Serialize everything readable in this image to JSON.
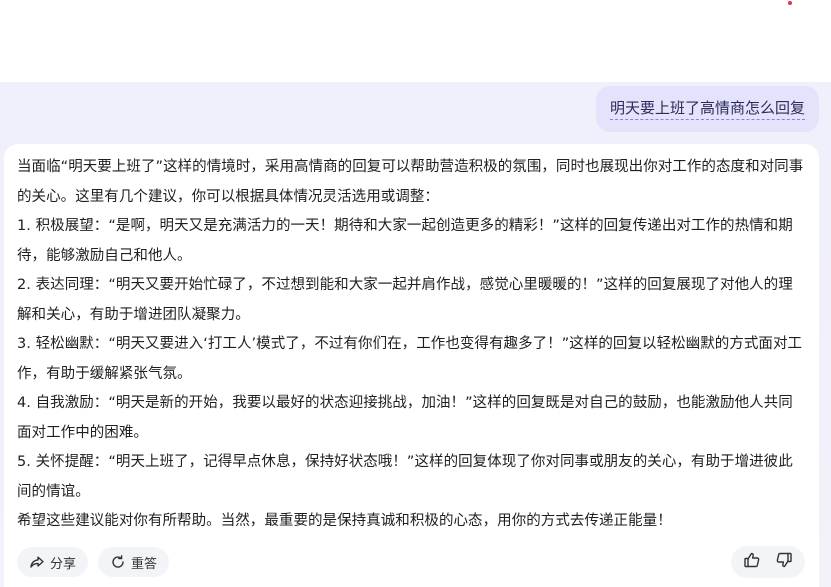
{
  "conversation": {
    "user_message": "明天要上班了高情商怎么回复",
    "assistant_paragraphs": [
      "当面临“明天要上班了”这样的情境时，采用高情商的回复可以帮助营造积极的氛围，同时也展现出你对工作的态度和对同事的关心。这里有几个建议，你可以根据具体情况灵活选用或调整：",
      "1. 积极展望：“是啊，明天又是充满活力的一天！期待和大家一起创造更多的精彩！”这样的回复传递出对工作的热情和期待，能够激励自己和他人。",
      "2. 表达同理：“明天又要开始忙碌了，不过想到能和大家一起并肩作战，感觉心里暖暖的！”这样的回复展现了对他人的理解和关心，有助于增进团队凝聚力。",
      "3. 轻松幽默：“明天又要进入‘打工人’模式了，不过有你们在，工作也变得有趣多了！”这样的回复以轻松幽默的方式面对工作，有助于缓解紧张气氛。",
      "4. 自我激励：“明天是新的开始，我要以最好的状态迎接挑战，加油！”这样的回复既是对自己的鼓励，也能激励他人共同面对工作中的困难。",
      "5. 关怀提醒：“明天上班了，记得早点休息，保持好状态哦！”这样的回复体现了你对同事或朋友的关心，有助于增进彼此间的情谊。",
      "希望这些建议能对你有所帮助。当然，最重要的是保持真诚和积极的心态，用你的方式去传递正能量！"
    ]
  },
  "actions": {
    "share_label": "分享",
    "regenerate_label": "重答",
    "share_icon": "share-icon",
    "regenerate_icon": "refresh-icon",
    "like_icon": "thumbs-up-icon",
    "dislike_icon": "thumbs-down-icon"
  },
  "colors": {
    "user_bubble": "#e4e3fb",
    "accent_underline": "#8a7cf0",
    "notification_dot": "#e0344f"
  }
}
